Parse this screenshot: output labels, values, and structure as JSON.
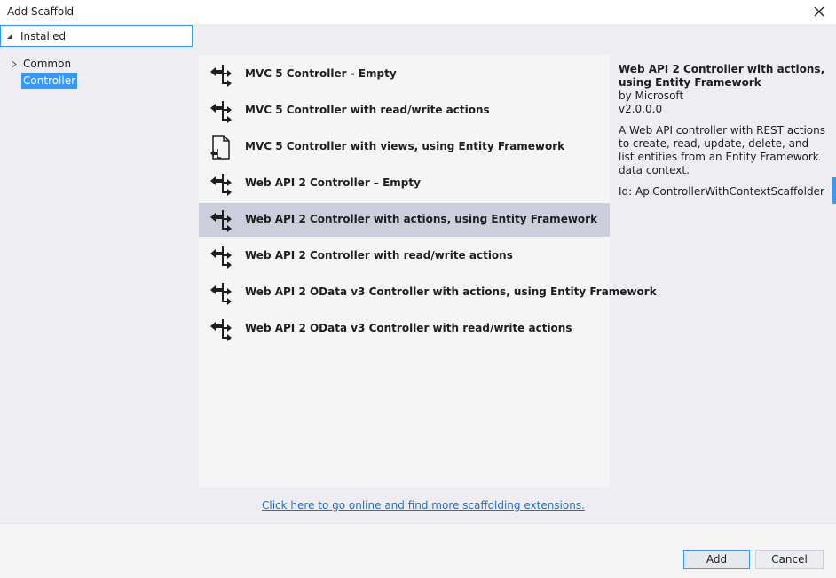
{
  "window": {
    "title": "Add Scaffold"
  },
  "tree": {
    "header_label": "Installed",
    "items": [
      {
        "label": "Common"
      },
      {
        "label": "Controller"
      }
    ]
  },
  "scaffolders": [
    {
      "label": "MVC 5 Controller - Empty",
      "icon": "controller-icon"
    },
    {
      "label": "MVC 5 Controller with read/write actions",
      "icon": "controller-icon"
    },
    {
      "label": "MVC 5 Controller with views, using Entity Framework",
      "icon": "view-document-icon"
    },
    {
      "label": "Web API 2 Controller – Empty",
      "icon": "controller-icon"
    },
    {
      "label": "Web API 2 Controller with actions, using Entity Framework",
      "icon": "controller-icon",
      "selected": true
    },
    {
      "label": "Web API 2 Controller with read/write actions",
      "icon": "controller-icon"
    },
    {
      "label": "Web API 2 OData v3 Controller with actions, using Entity Framework",
      "icon": "controller-icon"
    },
    {
      "label": "Web API 2 OData v3 Controller with read/write actions",
      "icon": "controller-icon"
    }
  ],
  "details": {
    "title": "Web API 2 Controller with actions, using Entity Framework",
    "author": "by Microsoft",
    "version": "v2.0.0.0",
    "description": "A Web API controller with REST actions to create, read, update, delete, and list entities from an Entity Framework data context.",
    "id": "Id: ApiControllerWithContextScaffolder"
  },
  "online_link": "Click here to go online and find more scaffolding extensions.",
  "buttons": {
    "add": "Add",
    "cancel": "Cancel"
  },
  "colors": {
    "selection": "#3399ff",
    "selected_row": "#cccedb",
    "link": "#1e6fc5"
  }
}
